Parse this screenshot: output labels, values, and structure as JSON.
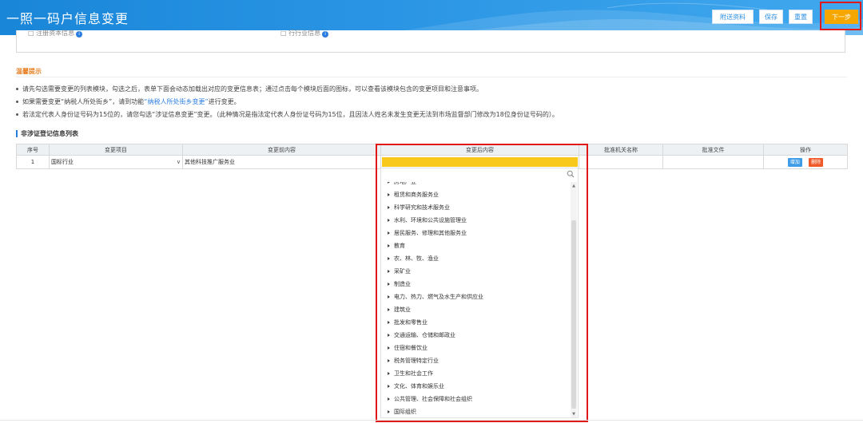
{
  "header": {
    "title": "一照一码户信息变更",
    "buttons": {
      "attach": "附送资料",
      "save": "保存",
      "reset": "重置",
      "next": "下一步"
    }
  },
  "top_box": {
    "left_cut": "□ 注册资本信息",
    "right_cut": "□ 行行业信息"
  },
  "tips": {
    "title": "温馨提示",
    "line1": "请先勾选需要变更的列表模块，勾选之后，表单下面会动态加载出对应的变更信息表；通过点击每个模块后面的图标，可以查看该模块包含的变更项目和注意事项。",
    "line2_pre": "如果需要变更“纳税人所处街乡”，请到功能",
    "line2_link": "“纳税人所处街乡变更”",
    "line2_post": "进行变更。",
    "line3": "若法定代表人身份证号码为15位的，请您勾选“涉证信息变更”变更。（此种情况是指法定代表人身份证号码为15位，且因法人姓名未发生变更无法到市场监督部门修改为18位身份证号码的）。"
  },
  "section_title": "非涉证登记信息列表",
  "table": {
    "headers": [
      "序号",
      "变更项目",
      "变更前内容",
      "变更后内容",
      "批准机关名称",
      "批准文件",
      "操作"
    ],
    "row": {
      "no": "1",
      "item": "国标行业",
      "before": "其他科技推广服务业",
      "after": "",
      "authority": "",
      "document": ""
    },
    "actions": {
      "add": "增加",
      "delete": "删除"
    }
  },
  "dropdown": {
    "search_value": "",
    "items": [
      "房地产业",
      "租赁和商务服务业",
      "科学研究和技术服务业",
      "水利、环境和公共设施管理业",
      "居民服务、修理和其他服务业",
      "教育",
      "农、林、牧、渔业",
      "采矿业",
      "制造业",
      "电力、热力、燃气及水生产和供应业",
      "建筑业",
      "批发和零售业",
      "交通运输、仓储和邮政业",
      "住宿和餐饮业",
      "税务管理特定行业",
      "卫生和社会工作",
      "文化、体育和娱乐业",
      "公共管理、社会保障和社会组织",
      "国际组织"
    ]
  },
  "colors": {
    "header_blue": "#1a86d8",
    "next_orange": "#f5a700",
    "highlight_red": "#e01818",
    "add_blue": "#3f9ce8",
    "delete_red": "#f05a28",
    "selected_yellow": "#f8c91a"
  }
}
